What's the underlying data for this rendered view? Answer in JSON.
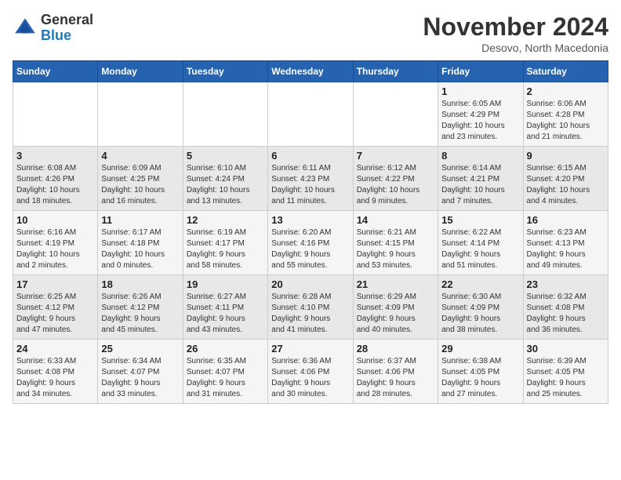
{
  "logo": {
    "general": "General",
    "blue": "Blue"
  },
  "header": {
    "month_year": "November 2024",
    "location": "Desovo, North Macedonia"
  },
  "weekdays": [
    "Sunday",
    "Monday",
    "Tuesday",
    "Wednesday",
    "Thursday",
    "Friday",
    "Saturday"
  ],
  "weeks": [
    [
      {
        "day": "",
        "info": ""
      },
      {
        "day": "",
        "info": ""
      },
      {
        "day": "",
        "info": ""
      },
      {
        "day": "",
        "info": ""
      },
      {
        "day": "",
        "info": ""
      },
      {
        "day": "1",
        "info": "Sunrise: 6:05 AM\nSunset: 4:29 PM\nDaylight: 10 hours\nand 23 minutes."
      },
      {
        "day": "2",
        "info": "Sunrise: 6:06 AM\nSunset: 4:28 PM\nDaylight: 10 hours\nand 21 minutes."
      }
    ],
    [
      {
        "day": "3",
        "info": "Sunrise: 6:08 AM\nSunset: 4:26 PM\nDaylight: 10 hours\nand 18 minutes."
      },
      {
        "day": "4",
        "info": "Sunrise: 6:09 AM\nSunset: 4:25 PM\nDaylight: 10 hours\nand 16 minutes."
      },
      {
        "day": "5",
        "info": "Sunrise: 6:10 AM\nSunset: 4:24 PM\nDaylight: 10 hours\nand 13 minutes."
      },
      {
        "day": "6",
        "info": "Sunrise: 6:11 AM\nSunset: 4:23 PM\nDaylight: 10 hours\nand 11 minutes."
      },
      {
        "day": "7",
        "info": "Sunrise: 6:12 AM\nSunset: 4:22 PM\nDaylight: 10 hours\nand 9 minutes."
      },
      {
        "day": "8",
        "info": "Sunrise: 6:14 AM\nSunset: 4:21 PM\nDaylight: 10 hours\nand 7 minutes."
      },
      {
        "day": "9",
        "info": "Sunrise: 6:15 AM\nSunset: 4:20 PM\nDaylight: 10 hours\nand 4 minutes."
      }
    ],
    [
      {
        "day": "10",
        "info": "Sunrise: 6:16 AM\nSunset: 4:19 PM\nDaylight: 10 hours\nand 2 minutes."
      },
      {
        "day": "11",
        "info": "Sunrise: 6:17 AM\nSunset: 4:18 PM\nDaylight: 10 hours\nand 0 minutes."
      },
      {
        "day": "12",
        "info": "Sunrise: 6:19 AM\nSunset: 4:17 PM\nDaylight: 9 hours\nand 58 minutes."
      },
      {
        "day": "13",
        "info": "Sunrise: 6:20 AM\nSunset: 4:16 PM\nDaylight: 9 hours\nand 55 minutes."
      },
      {
        "day": "14",
        "info": "Sunrise: 6:21 AM\nSunset: 4:15 PM\nDaylight: 9 hours\nand 53 minutes."
      },
      {
        "day": "15",
        "info": "Sunrise: 6:22 AM\nSunset: 4:14 PM\nDaylight: 9 hours\nand 51 minutes."
      },
      {
        "day": "16",
        "info": "Sunrise: 6:23 AM\nSunset: 4:13 PM\nDaylight: 9 hours\nand 49 minutes."
      }
    ],
    [
      {
        "day": "17",
        "info": "Sunrise: 6:25 AM\nSunset: 4:12 PM\nDaylight: 9 hours\nand 47 minutes."
      },
      {
        "day": "18",
        "info": "Sunrise: 6:26 AM\nSunset: 4:12 PM\nDaylight: 9 hours\nand 45 minutes."
      },
      {
        "day": "19",
        "info": "Sunrise: 6:27 AM\nSunset: 4:11 PM\nDaylight: 9 hours\nand 43 minutes."
      },
      {
        "day": "20",
        "info": "Sunrise: 6:28 AM\nSunset: 4:10 PM\nDaylight: 9 hours\nand 41 minutes."
      },
      {
        "day": "21",
        "info": "Sunrise: 6:29 AM\nSunset: 4:09 PM\nDaylight: 9 hours\nand 40 minutes."
      },
      {
        "day": "22",
        "info": "Sunrise: 6:30 AM\nSunset: 4:09 PM\nDaylight: 9 hours\nand 38 minutes."
      },
      {
        "day": "23",
        "info": "Sunrise: 6:32 AM\nSunset: 4:08 PM\nDaylight: 9 hours\nand 36 minutes."
      }
    ],
    [
      {
        "day": "24",
        "info": "Sunrise: 6:33 AM\nSunset: 4:08 PM\nDaylight: 9 hours\nand 34 minutes."
      },
      {
        "day": "25",
        "info": "Sunrise: 6:34 AM\nSunset: 4:07 PM\nDaylight: 9 hours\nand 33 minutes."
      },
      {
        "day": "26",
        "info": "Sunrise: 6:35 AM\nSunset: 4:07 PM\nDaylight: 9 hours\nand 31 minutes."
      },
      {
        "day": "27",
        "info": "Sunrise: 6:36 AM\nSunset: 4:06 PM\nDaylight: 9 hours\nand 30 minutes."
      },
      {
        "day": "28",
        "info": "Sunrise: 6:37 AM\nSunset: 4:06 PM\nDaylight: 9 hours\nand 28 minutes."
      },
      {
        "day": "29",
        "info": "Sunrise: 6:38 AM\nSunset: 4:05 PM\nDaylight: 9 hours\nand 27 minutes."
      },
      {
        "day": "30",
        "info": "Sunrise: 6:39 AM\nSunset: 4:05 PM\nDaylight: 9 hours\nand 25 minutes."
      }
    ]
  ]
}
